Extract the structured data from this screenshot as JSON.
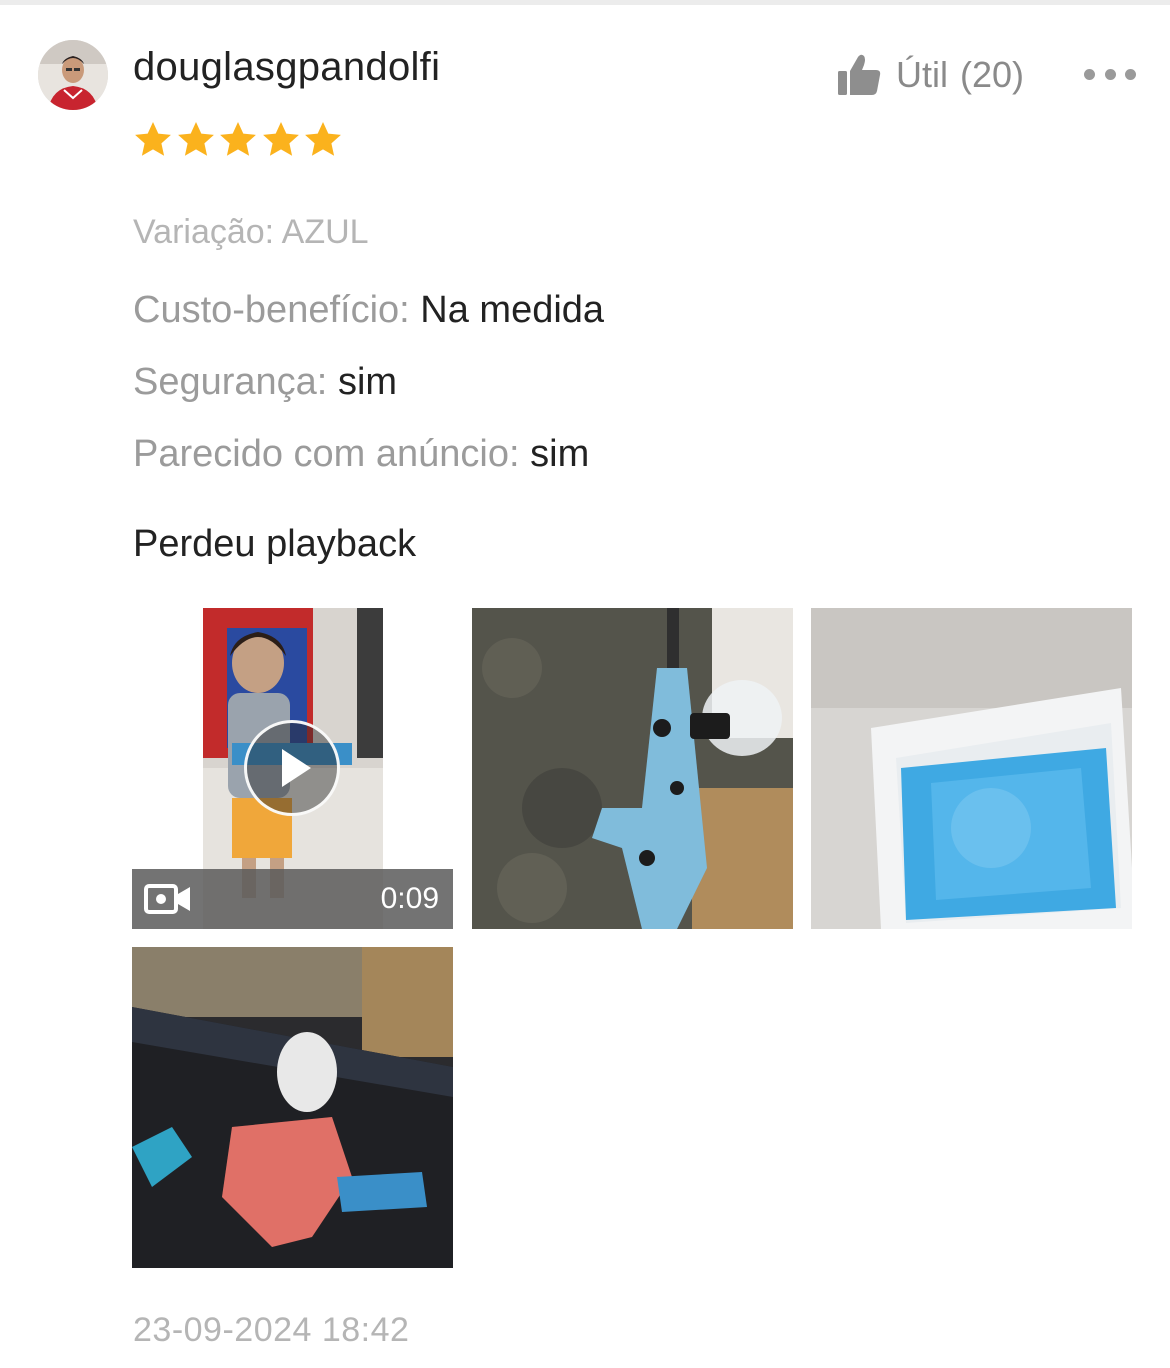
{
  "review": {
    "username": "douglasgpandolfi",
    "rating": 5,
    "rating_max": 5,
    "helpful_label": "Útil",
    "helpful_count": "(20)",
    "variation": "Variação: AZUL",
    "attributes": [
      {
        "label": "Custo-benefício:",
        "value": "Na medida"
      },
      {
        "label": "Segurança:",
        "value": "sim"
      },
      {
        "label": "Parecido com anúncio:",
        "value": "sim"
      }
    ],
    "text": "Perdeu playback",
    "video_duration": "0:09",
    "timestamp": "23-09-2024 18:42"
  },
  "colors": {
    "star": "#fbb21d",
    "muted_text": "#9b9b9b",
    "light_text": "#b5b5b5",
    "primary_text": "#222222"
  },
  "icons": [
    "thumbs-up-icon",
    "more-icon",
    "star-icon",
    "video-camera-icon",
    "play-icon"
  ]
}
